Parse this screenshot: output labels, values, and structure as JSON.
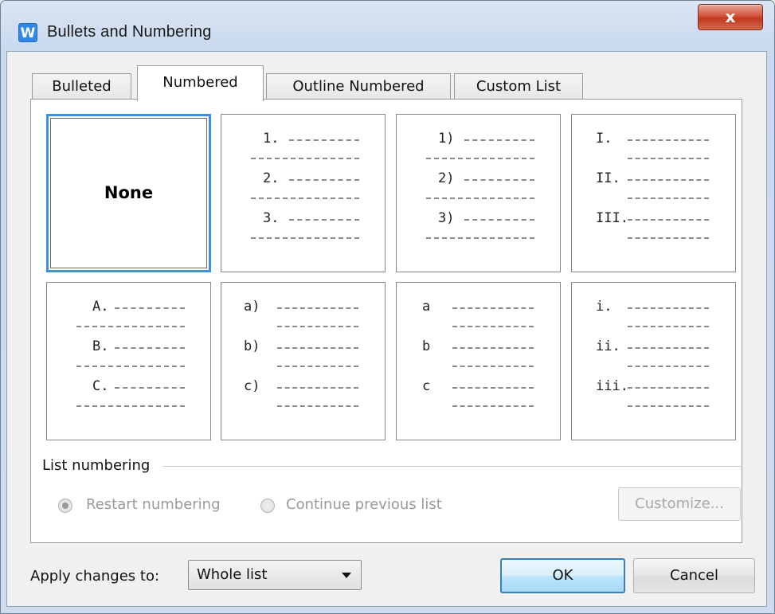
{
  "window": {
    "title": "Bullets and Numbering",
    "app_icon_letter": "W",
    "close_label": "x"
  },
  "tabs": [
    {
      "label": "Bulleted"
    },
    {
      "label": "Numbered",
      "active": true
    },
    {
      "label": "Outline Numbered"
    },
    {
      "label": "Custom List"
    }
  ],
  "gallery": {
    "none_label": "None",
    "styles": [
      {
        "id": "arabic-period",
        "labels": [
          "1.",
          "2.",
          "3."
        ]
      },
      {
        "id": "arabic-paren",
        "labels": [
          "1)",
          "2)",
          "3)"
        ]
      },
      {
        "id": "roman-upper",
        "labels": [
          "I.",
          "II.",
          "III."
        ]
      },
      {
        "id": "alpha-upper",
        "labels": [
          "A.",
          "B.",
          "C."
        ]
      },
      {
        "id": "alpha-lower-paren",
        "labels": [
          "a)",
          "b)",
          "c)"
        ]
      },
      {
        "id": "alpha-lower",
        "labels": [
          "a",
          "b",
          "c"
        ]
      },
      {
        "id": "roman-lower",
        "labels": [
          "i.",
          "ii.",
          "iii."
        ]
      }
    ]
  },
  "list_numbering": {
    "group_label": "List numbering",
    "restart_label": "Restart numbering",
    "continue_label": "Continue previous list",
    "customize_label": "Customize..."
  },
  "footer": {
    "apply_label": "Apply changes to:",
    "apply_value": "Whole list",
    "ok_label": "OK",
    "cancel_label": "Cancel"
  },
  "colors": {
    "selection_border": "#3d8ee6",
    "close_button": "#c0381c",
    "default_button_border": "#3c7fb1"
  }
}
